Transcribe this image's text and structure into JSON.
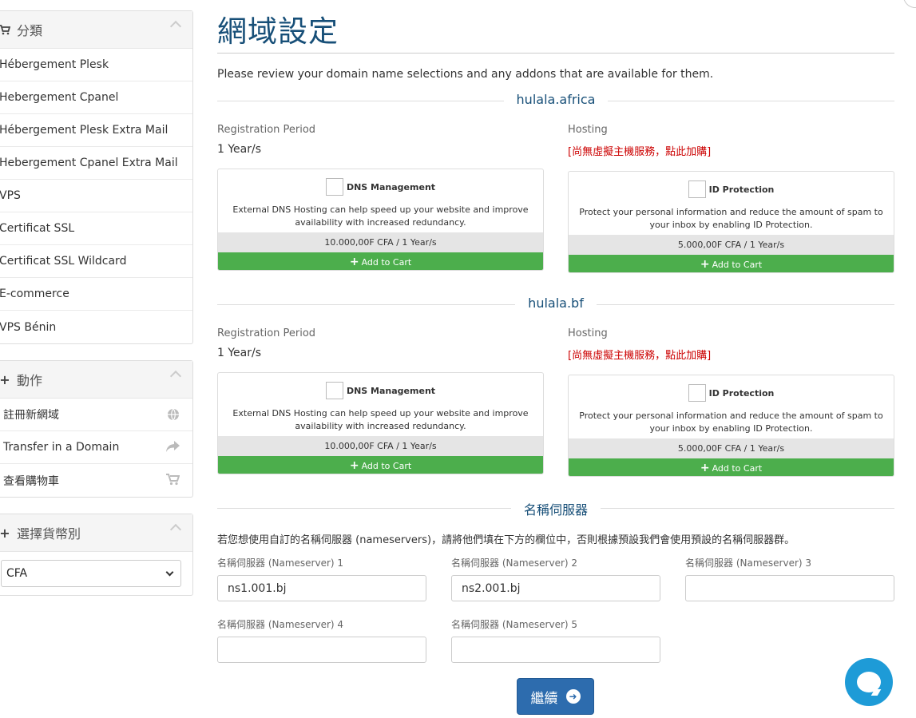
{
  "sidebar": {
    "categories": {
      "title": "分類",
      "icon": "cart-icon",
      "items": [
        "Hébergement Plesk",
        "Hebergement Cpanel",
        "Hébergement Plesk Extra Mail",
        "Hebergement Cpanel Extra Mail",
        "VPS",
        "Certificat SSL",
        "Certificat SSL Wildcard",
        "E-commerce",
        "VPS Bénin"
      ]
    },
    "actions": {
      "title": "動作",
      "icon": "plus-icon",
      "items": [
        {
          "label": "註冊新網域",
          "icon": "globe-icon"
        },
        {
          "label": "Transfer in a Domain",
          "icon": "share-icon"
        },
        {
          "label": "查看購物車",
          "icon": "cart-icon"
        }
      ]
    },
    "currency": {
      "title": "選擇貨幣別",
      "icon": "plus-icon",
      "selected": "CFA"
    }
  },
  "main": {
    "title": "網域設定",
    "intro": "Please review your domain name selections and any addons that are available for them.",
    "domains": [
      {
        "name": "hulala.africa",
        "reg_label": "Registration Period",
        "reg_value": "1 Year/s",
        "hosting_label": "Hosting",
        "hosting_link": "[尚無虛擬主機服務，點此加購]",
        "addons": [
          {
            "name": "DNS Management",
            "desc": "External DNS Hosting can help speed up your website and improve availability with increased redundancy.",
            "price": "10.000,00F CFA / 1 Year/s",
            "button": "Add to Cart"
          },
          {
            "name": "ID Protection",
            "desc": "Protect your personal information and reduce the amount of spam to your inbox by enabling ID Protection.",
            "price": "5.000,00F CFA / 1 Year/s",
            "button": "Add to Cart"
          }
        ]
      },
      {
        "name": "hulala.bf",
        "reg_label": "Registration Period",
        "reg_value": "1 Year/s",
        "hosting_label": "Hosting",
        "hosting_link": "[尚無虛擬主機服務，點此加購]",
        "addons": [
          {
            "name": "DNS Management",
            "desc": "External DNS Hosting can help speed up your website and improve availability with increased redundancy.",
            "price": "10.000,00F CFA / 1 Year/s",
            "button": "Add to Cart"
          },
          {
            "name": "ID Protection",
            "desc": "Protect your personal information and reduce the amount of spam to your inbox by enabling ID Protection.",
            "price": "5.000,00F CFA / 1 Year/s",
            "button": "Add to Cart"
          }
        ]
      }
    ],
    "nameservers": {
      "title": "名稱伺服器",
      "intro": "若您想使用自訂的名稱伺服器 (nameservers)，請將他們填在下方的欄位中，否則根據預設我們會使用預設的名稱伺服器群。",
      "fields": [
        {
          "label": "名稱伺服器 (Nameserver) 1",
          "value": "ns1.001.bj"
        },
        {
          "label": "名稱伺服器 (Nameserver) 2",
          "value": "ns2.001.bj"
        },
        {
          "label": "名稱伺服器 (Nameserver) 3",
          "value": ""
        },
        {
          "label": "名稱伺服器 (Nameserver) 4",
          "value": ""
        },
        {
          "label": "名稱伺服器 (Nameserver) 5",
          "value": ""
        }
      ]
    },
    "continue_label": "繼續"
  },
  "colors": {
    "title": "#174f78",
    "accent_green": "#4cae4c",
    "primary_blue": "#2d6cae",
    "hosting_red": "#cc0000",
    "chat": "#1e9bd7"
  }
}
